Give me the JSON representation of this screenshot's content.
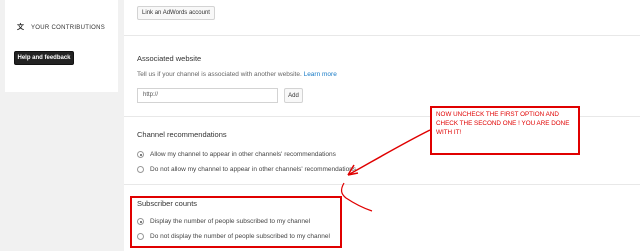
{
  "sidebar": {
    "contributions_label": "YOUR CONTRIBUTIONS",
    "contributions_icon": "translate-icon",
    "help_button_label": "Help and feedback"
  },
  "adwords": {
    "link_button_label": "Link an AdWords account"
  },
  "associated_website": {
    "title": "Associated website",
    "description": "Tell us if your channel is associated with another website.",
    "learn_more": "Learn more",
    "url_value": "http://",
    "add_button_label": "Add"
  },
  "channel_recommendations": {
    "title": "Channel recommendations",
    "options": [
      {
        "label": "Allow my channel to appear in other channels' recommendations",
        "checked": true
      },
      {
        "label": "Do not allow my channel to appear in other channels' recommendations",
        "checked": false
      }
    ]
  },
  "subscriber_counts": {
    "title": "Subscriber counts",
    "options": [
      {
        "label": "Display the number of people subscribed to my channel",
        "checked": true
      },
      {
        "label": "Do not display the number of people subscribed to my channel",
        "checked": false
      }
    ]
  },
  "annotation": {
    "note": "NOW UNCHECK THE FIRST OPTION AND CHECK THE SECOND ONE ! YOU ARE DONE WITH IT!",
    "color": "#e00000"
  },
  "colors": {
    "link": "#167ac6",
    "page_background": "#f1f1f1"
  }
}
